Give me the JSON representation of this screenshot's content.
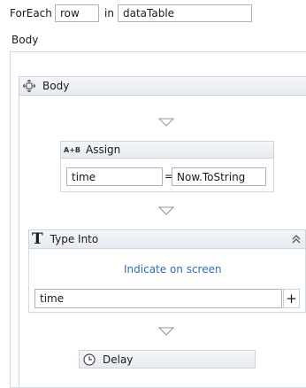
{
  "foreach": {
    "label": "ForEach",
    "item_value": "row",
    "in_label": "in",
    "collection_value": "dataTable"
  },
  "body_label": "Body",
  "body_sequence": {
    "title": "Body"
  },
  "assign": {
    "icon_text": "A+B",
    "title": "Assign",
    "to_value": "time",
    "equals": "=",
    "value": "Now.ToString"
  },
  "type_into": {
    "title": "Type Into",
    "indicate_link": "Indicate on screen",
    "text_value": "time",
    "plus": "+"
  },
  "delay": {
    "title": "Delay"
  }
}
